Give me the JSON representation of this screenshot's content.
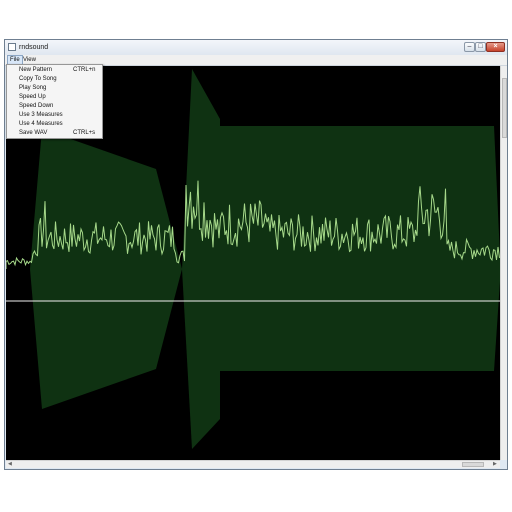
{
  "window": {
    "title": "rndsound"
  },
  "menubar": {
    "file": "File",
    "view": "View"
  },
  "file_menu": {
    "items": [
      {
        "label": "New Pattern",
        "shortcut": "CTRL+n"
      },
      {
        "label": "Copy To Song",
        "shortcut": ""
      },
      {
        "label": "Play Song",
        "shortcut": ""
      },
      {
        "label": "Speed Up",
        "shortcut": ""
      },
      {
        "label": "Speed Down",
        "shortcut": ""
      },
      {
        "label": "Use 3 Measures",
        "shortcut": ""
      },
      {
        "label": "Use 4 Measures",
        "shortcut": ""
      },
      {
        "label": "Save WAV",
        "shortcut": "CTRL+s"
      }
    ]
  },
  "colors": {
    "background": "#000000",
    "envelope": "#0f3212",
    "waveform": "#a6d98a",
    "centerline": "#f0f0f0"
  }
}
